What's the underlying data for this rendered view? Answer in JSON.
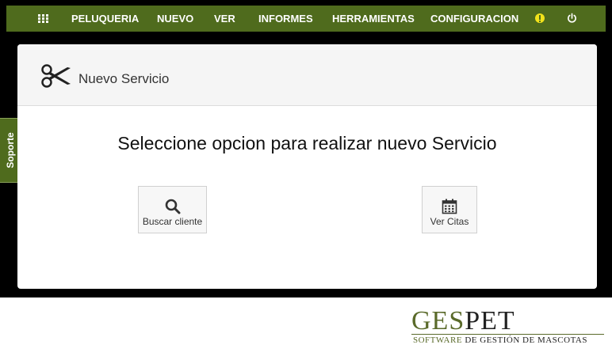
{
  "nav": {
    "items": [
      "PELUQUERIA",
      "NUEVO",
      "VER",
      "INFORMES",
      "HERRAMIENTAS",
      "CONFIGURACION"
    ],
    "menu_icon": "grid-icon",
    "alert_icon": "exclamation-circle-icon",
    "power_icon": "power-icon"
  },
  "panel": {
    "title": "Nuevo Servicio",
    "title_icon": "scissors-icon",
    "heading": "Seleccione opcion para realizar nuevo Servicio",
    "options": [
      {
        "label": "Buscar cliente",
        "icon": "search-icon"
      },
      {
        "label": "Ver Citas",
        "icon": "calendar-icon"
      }
    ]
  },
  "support_tab": "Soporte",
  "logo": {
    "brand_part1": "GES",
    "brand_part2": "PET",
    "tagline_part1": "SOFTWARE ",
    "tagline_part2": "DE GESTIÓN DE MASCOTAS"
  },
  "colors": {
    "nav_bg": "#4f6b1d",
    "alert": "#f2e31b",
    "brand_green": "#5a6a2a"
  }
}
